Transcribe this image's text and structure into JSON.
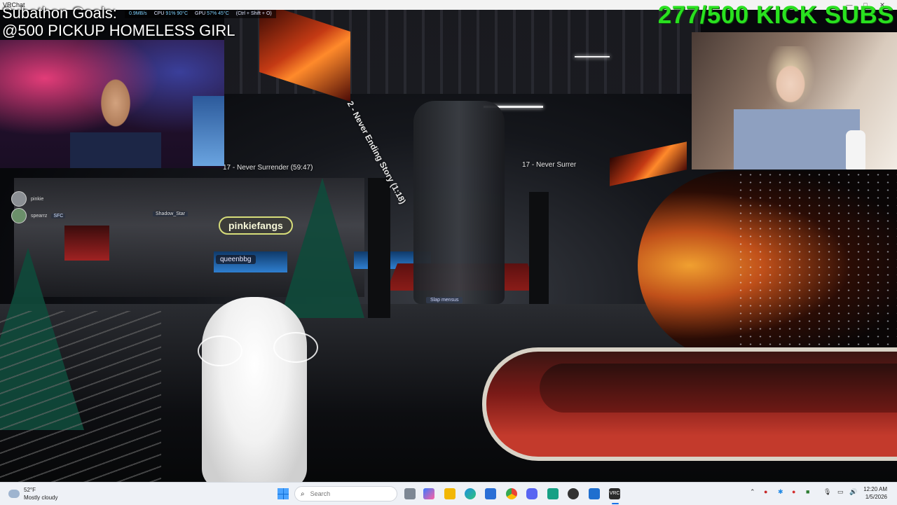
{
  "window": {
    "title": "VRChat"
  },
  "perf": [
    {
      "label": "",
      "value": "0.9MB/s"
    },
    {
      "label": "CPU",
      "value": "91%  90°C"
    },
    {
      "label": "GPU",
      "value": "57%  45°C"
    },
    {
      "label": "",
      "value": "(Ctrl + Shift + O)"
    }
  ],
  "overlay": {
    "goals_title": "Subathon Goals:",
    "goal_line": "@500 PICKUP HOMELESS GIRL",
    "sub_counter": "277/500 KICK SUBS"
  },
  "scene": {
    "sign_left": "17 - Never Surrender (59:47)",
    "sign_right": "17 - Never Surrer",
    "sign_banner": "2 - Never Ending Story (1:18)",
    "nameplate": "pinkiefangs",
    "nameplate_small": "queenbbg",
    "world_tag": "Slap mensus",
    "player_tag": "Shadow_Star"
  },
  "userlist": [
    {
      "name": "pinkie",
      "badge": ""
    },
    {
      "name": "spearrz",
      "badge": "SFC"
    }
  ],
  "taskbar": {
    "weather_temp": "52°F",
    "weather_desc": "Mostly cloudy",
    "search_placeholder": "Search",
    "time": "12:20 AM",
    "date": "1/5/2026",
    "apps": [
      "file-explorer-icon",
      "copilot-icon",
      "folder-icon",
      "edge-icon",
      "store-icon",
      "chrome-icon",
      "discord-icon",
      "app-icon",
      "obs-icon",
      "vscode-icon",
      "vrchat-icon"
    ]
  },
  "colors": {
    "sub_counter": "#29e11f",
    "nameplate_border": "#d7dd7a",
    "taskbar_bg": "#eef1f6"
  }
}
